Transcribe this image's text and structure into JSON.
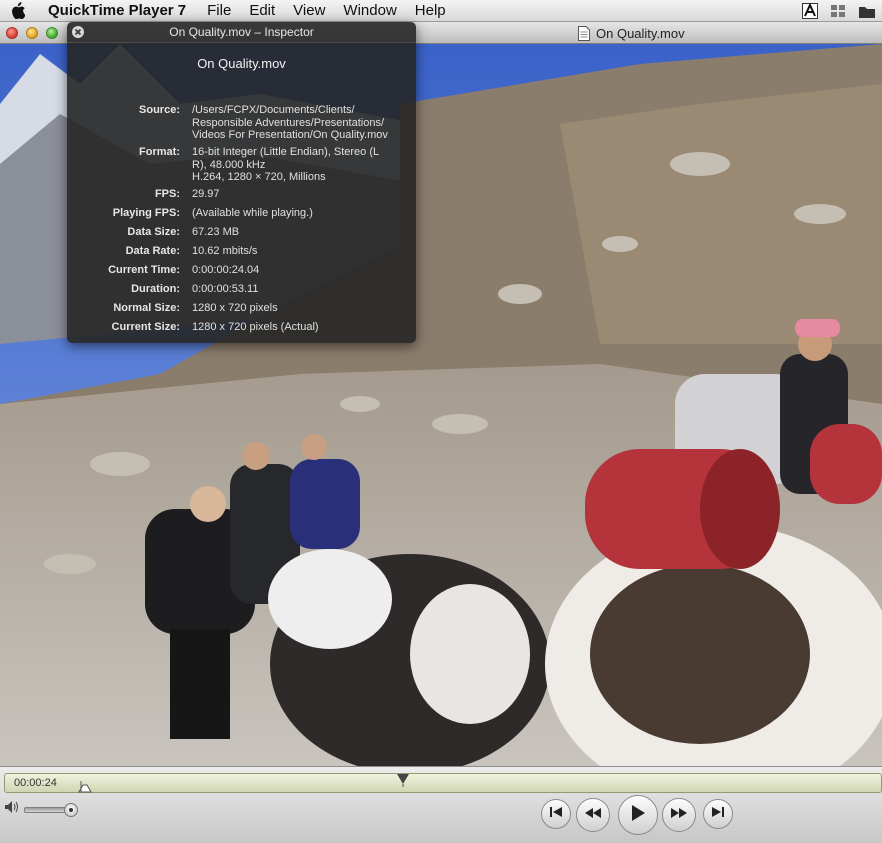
{
  "menubar": {
    "app_name": "QuickTime Player 7",
    "menus": [
      "File",
      "Edit",
      "View",
      "Window",
      "Help"
    ]
  },
  "window": {
    "title": "On Quality.mov"
  },
  "inspector": {
    "title": "On Quality.mov – Inspector",
    "filename": "On Quality.mov",
    "rows": [
      {
        "label": "Source:",
        "lines": [
          "/Users/FCPX/Documents/Clients/",
          "Responsible Adventures/Presentations/",
          "Videos For Presentation/On Quality.mov"
        ]
      },
      {
        "label": "Format:",
        "lines": [
          "16-bit Integer (Little Endian), Stereo (L",
          "R), 48.000 kHz",
          "H.264, 1280 × 720, Millions"
        ]
      },
      {
        "label": "FPS:",
        "lines": [
          "29.97"
        ]
      },
      {
        "label": "Playing FPS:",
        "lines": [
          "(Available while playing.)"
        ]
      },
      {
        "label": "Data Size:",
        "lines": [
          "67.23 MB"
        ]
      },
      {
        "label": "Data Rate:",
        "lines": [
          "10.62 mbits/s"
        ]
      },
      {
        "label": "Current Time:",
        "lines": [
          "0:00:00:24.04"
        ]
      },
      {
        "label": "Duration:",
        "lines": [
          "0:00:00:53.11"
        ]
      },
      {
        "label": "Normal Size:",
        "lines": [
          "1280 x 720 pixels"
        ]
      },
      {
        "label": "Current Size:",
        "lines": [
          "1280 x 720 pixels (Actual)"
        ]
      }
    ]
  },
  "controller": {
    "timecode": "00:00:24",
    "progress_fraction": 0.453,
    "volume_fraction": 1.0
  },
  "icons": {
    "apple": "apple-logo-icon",
    "doc": "document-icon",
    "inspector_close": "close-icon",
    "volume": "speaker-icon",
    "playhead": "playhead-icon",
    "skip_back": "skip-to-start-icon",
    "rewind": "rewind-icon",
    "play": "play-icon",
    "fast_forward": "fast-forward-icon",
    "skip_forward": "skip-to-end-icon"
  },
  "colors": {
    "hud_background": "#262626",
    "scrubber_fill": "#dfe5c6",
    "close_red": "#e0443a",
    "minimize_yellow": "#e9a825",
    "zoom_green": "#4bb13a"
  }
}
